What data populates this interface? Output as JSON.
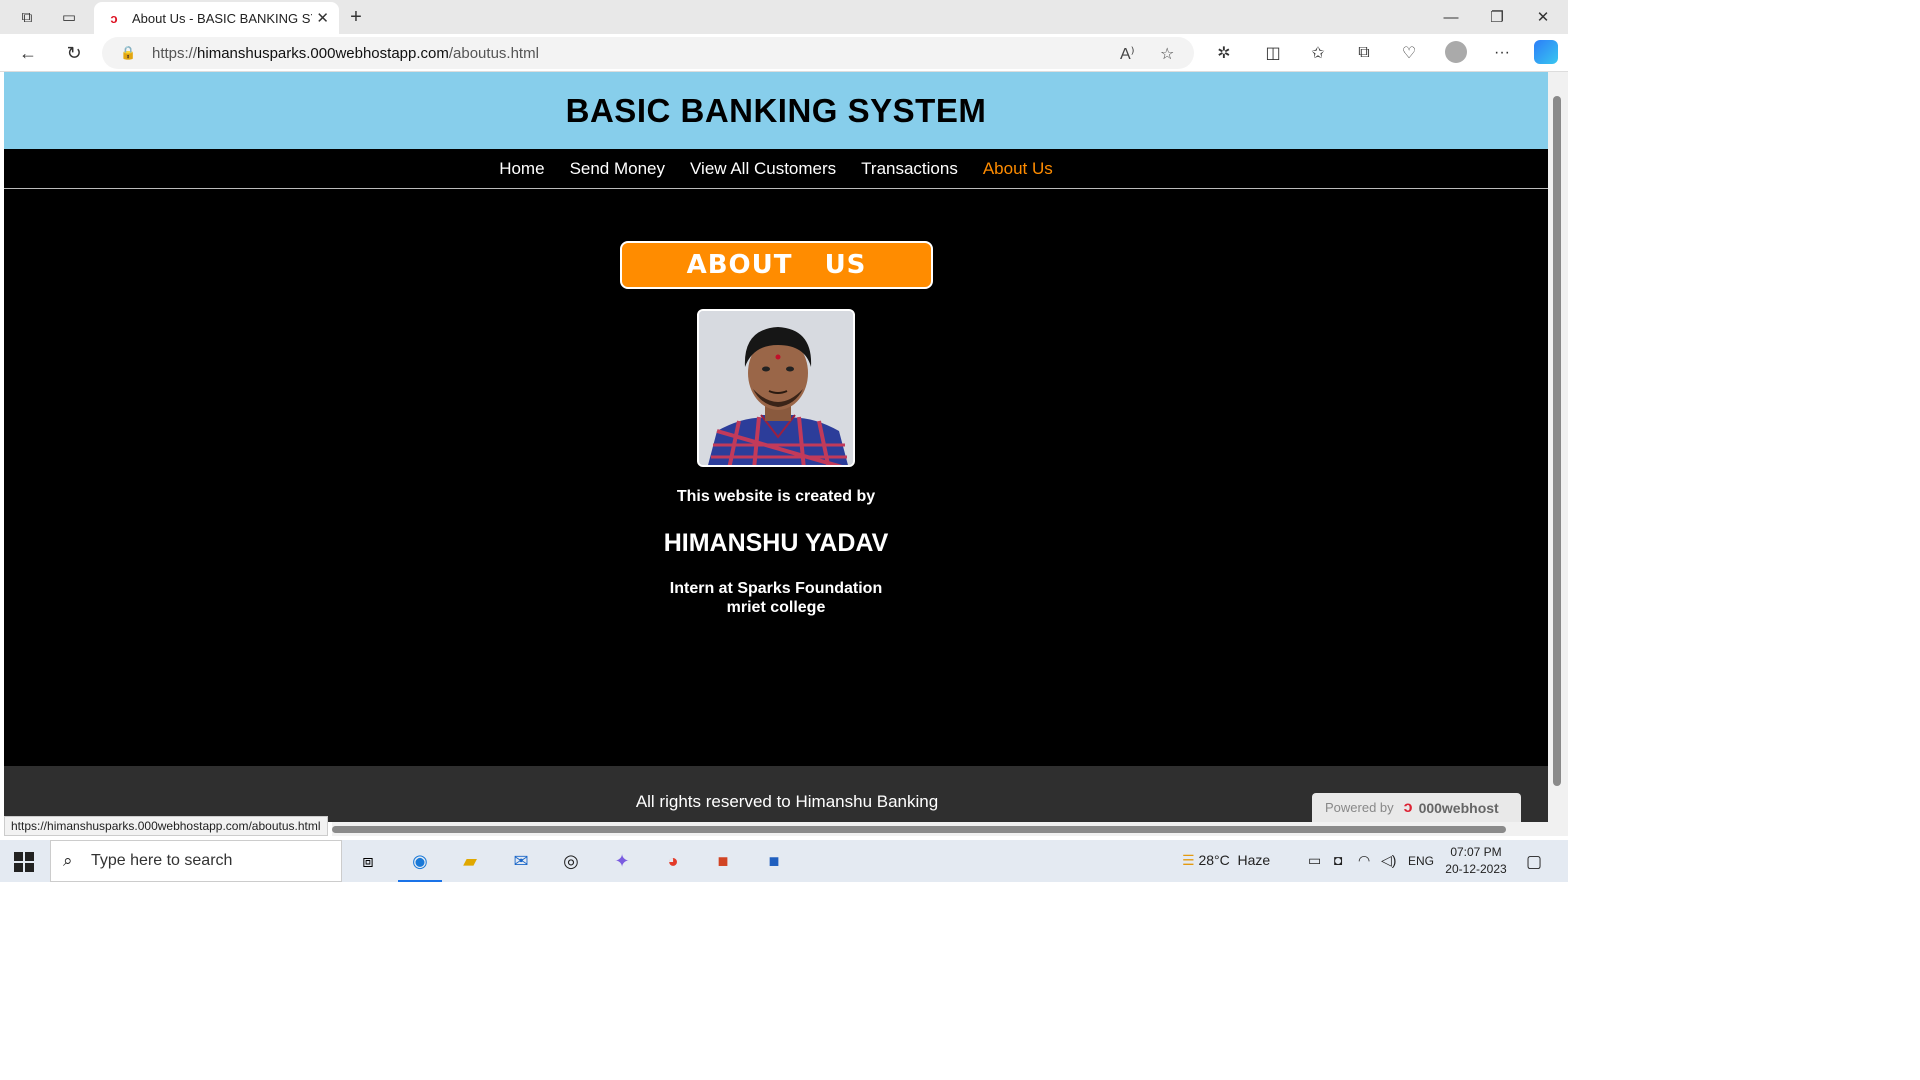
{
  "browser": {
    "tab_title": "About Us - BASIC BANKING SYST",
    "url_prefix": "https://",
    "url_host": "himanshusparks.000webhostapp.com",
    "url_path": "/aboutus.html",
    "status_url": "https://himanshusparks.000webhostapp.com/aboutus.html"
  },
  "site": {
    "title": "BASIC BANKING SYSTEM",
    "nav": [
      "Home",
      "Send Money",
      "View All Customers",
      "Transactions",
      "About Us"
    ],
    "active_nav": "About Us",
    "banner": "ABOUT  US",
    "created_by": "This website is created by",
    "author": "HIMANSHU YADAV",
    "role_line1": "Intern at Sparks Foundation",
    "role_line2": "mriet college",
    "footer": "All rights reserved to Himanshu Banking",
    "powered_by": "Powered by",
    "powered_brand": "000webhost",
    "colors": {
      "header": "#87ceeb",
      "accent": "#ff8c00",
      "page": "#000000",
      "footer": "#2f2f2f"
    }
  },
  "taskbar": {
    "search_placeholder": "Type here to search",
    "weather": "28°C  Haze",
    "lang": "ENG",
    "time": "07:07 PM",
    "date": "20-12-2023"
  }
}
